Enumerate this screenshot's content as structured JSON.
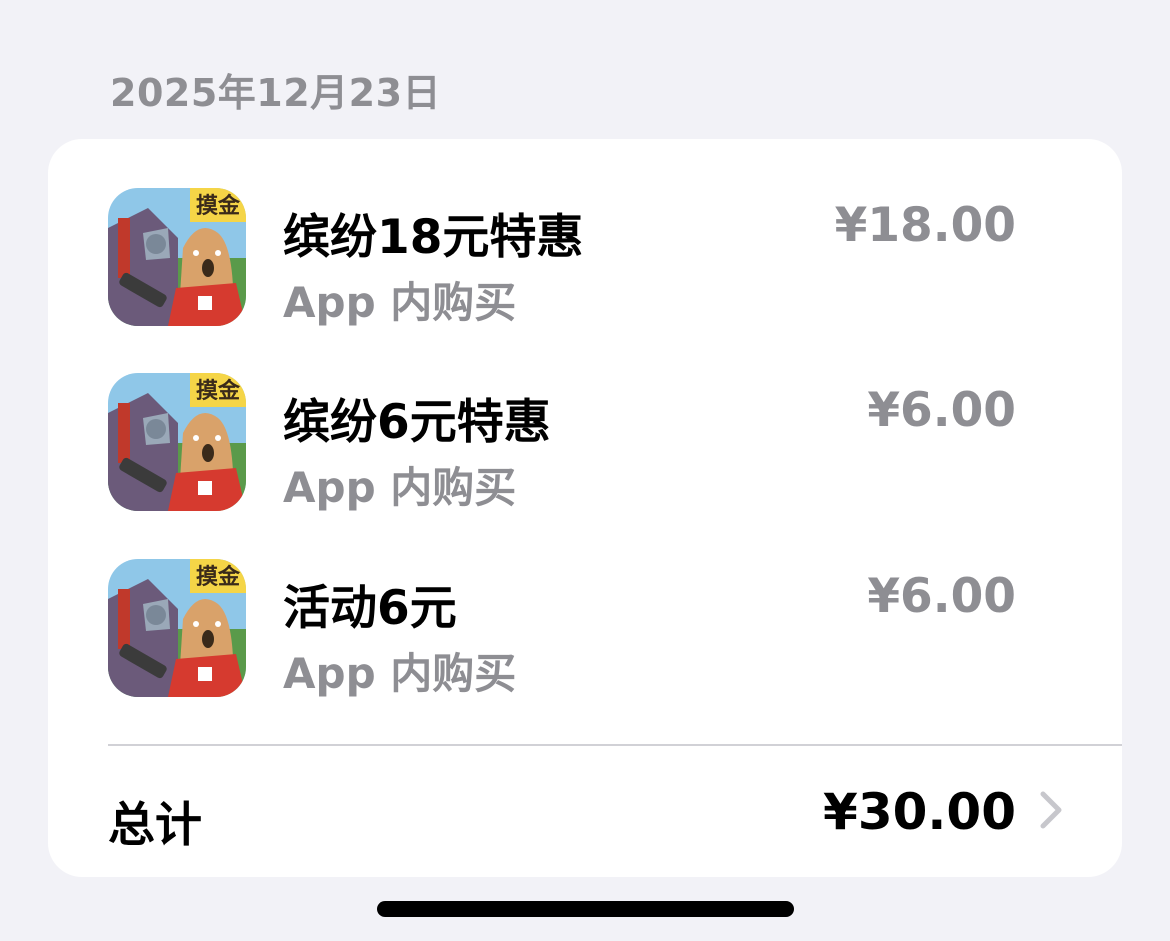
{
  "date_header": "2025年12月23日",
  "icon_badge": "摸金",
  "purchases": [
    {
      "title": "缤纷18元特惠",
      "subtitle": "App 内购买",
      "price": "¥18.00"
    },
    {
      "title": "缤纷6元特惠",
      "subtitle": "App 内购买",
      "price": "¥6.00"
    },
    {
      "title": "活动6元",
      "subtitle": "App 内购买",
      "price": "¥6.00"
    }
  ],
  "total": {
    "label": "总计",
    "amount": "¥30.00"
  },
  "icons": {
    "app": "game-app-icon",
    "chevron": "chevron-right-icon"
  },
  "colors": {
    "background": "#f2f2f7",
    "card": "#ffffff",
    "secondary_text": "#8e8e93",
    "primary_text": "#000000",
    "badge_yellow": "#f5d547"
  }
}
